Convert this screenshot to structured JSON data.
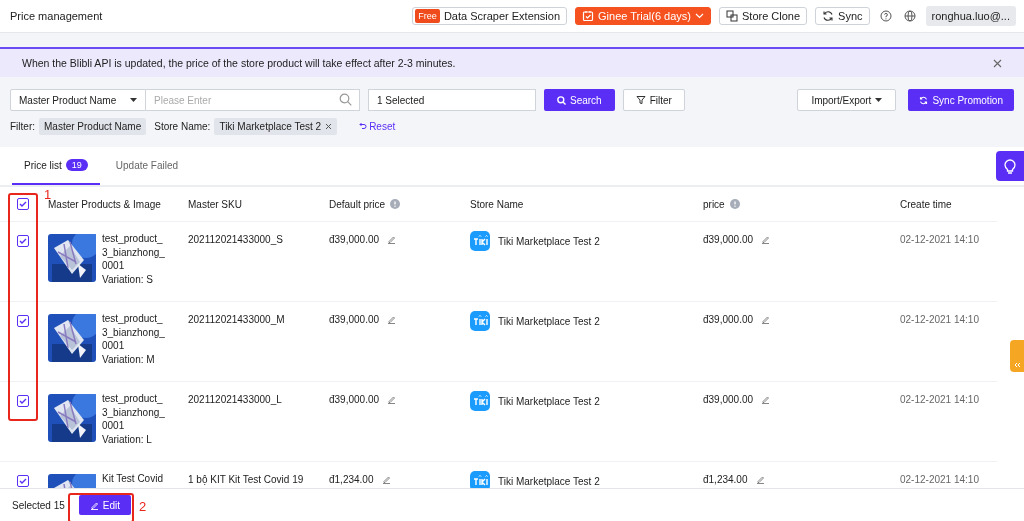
{
  "header": {
    "title": "Price management",
    "free_badge": "Free",
    "extension": "Data Scraper Extension",
    "trial": "Ginee Trial(6 days)",
    "store_clone": "Store Clone",
    "sync": "Sync",
    "account": "ronghua.luo@..."
  },
  "notice": {
    "text": "When the Blibli API is updated, the price of the store product will take effect after 2-3 minutes."
  },
  "filters": {
    "field_select": "Master Product Name",
    "search_placeholder": "Please Enter",
    "store_select": "1 Selected",
    "search_button": "Search",
    "filter_button": "Filter",
    "import_export": "Import/Export",
    "sync_promotion": "Sync Promotion",
    "filter_label": "Filter:",
    "chips": [
      {
        "label": "Master Product Name",
        "removable": false
      },
      {
        "label": "Tiki Marketplace Test 2",
        "prefix": "Store Name:",
        "removable": true
      }
    ],
    "reset": "Reset"
  },
  "tabs": [
    {
      "label": "Price list",
      "count": "19",
      "selected": true
    },
    {
      "label": "Update Failed",
      "selected": false
    }
  ],
  "table": {
    "all_checked": true,
    "columns": [
      "Master Products & Image",
      "Master SKU",
      "Default price",
      "Store Name",
      "price",
      "Create time"
    ],
    "rows": [
      {
        "checked": true,
        "product": "test_product_\n3_bianzhong_\n0001",
        "variation": "Variation: S",
        "sku": "202112021433000_S",
        "default_price": "đ39,000.00",
        "store": "Tiki Marketplace Test 2",
        "price": "đ39,000.00",
        "created": "02-12-2021 14:10"
      },
      {
        "checked": true,
        "product": "test_product_\n3_bianzhong_\n0001",
        "variation": "Variation: M",
        "sku": "202112021433000_M",
        "default_price": "đ39,000.00",
        "store": "Tiki Marketplace Test 2",
        "price": "đ39,000.00",
        "created": "02-12-2021 14:10"
      },
      {
        "checked": true,
        "product": "test_product_\n3_bianzhong_\n0001",
        "variation": "Variation: L",
        "sku": "202112021433000_L",
        "default_price": "đ39,000.00",
        "store": "Tiki Marketplace Test 2",
        "price": "đ39,000.00",
        "created": "02-12-2021 14:10"
      },
      {
        "checked": true,
        "product": "Kit Test Covid",
        "sku": "1 bộ KIT Kit Test Covid 19",
        "default_price": "đ1,234.00",
        "store": "Tiki Marketplace Test 2",
        "price": "đ1,234.00",
        "created": "02-12-2021 14:10"
      }
    ]
  },
  "footer": {
    "selected": "Selected 15",
    "edit": "Edit"
  },
  "annotations": [
    "1",
    "2"
  ]
}
